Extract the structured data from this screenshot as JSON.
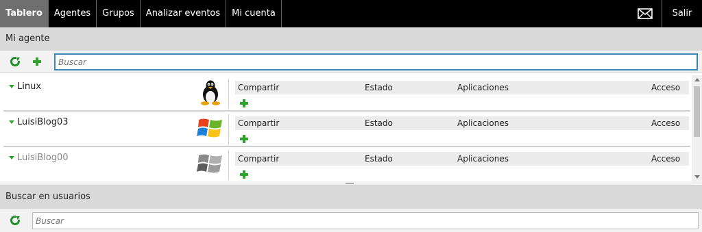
{
  "nav": {
    "items": [
      {
        "label": "Tablero",
        "active": true
      },
      {
        "label": "Agentes",
        "active": false
      },
      {
        "label": "Grupos",
        "active": false
      },
      {
        "label": "Analizar eventos",
        "active": false
      },
      {
        "label": "Mi cuenta",
        "active": false
      }
    ],
    "mail_icon": "envelope-icon",
    "logout_label": "Salir"
  },
  "my_agent": {
    "title": "Mi agente",
    "search_placeholder": "Buscar",
    "agents": [
      {
        "name": "Linux",
        "os": "linux",
        "dim": false
      },
      {
        "name": "LuisiBlog03",
        "os": "windows",
        "dim": false
      },
      {
        "name": "LuisiBlog00",
        "os": "windows-gray",
        "dim": true
      }
    ],
    "columns": {
      "share": "Compartir",
      "status": "Estado",
      "apps": "Aplicaciones",
      "access": "Acceso"
    }
  },
  "user_search": {
    "title": "Buscar en usuarios",
    "search_placeholder": "Buscar"
  },
  "colors": {
    "accent_green": "#2ea12e",
    "nav_bg": "#000000",
    "nav_active": "#6f6f6f",
    "section_bg": "#d9d9d9"
  }
}
